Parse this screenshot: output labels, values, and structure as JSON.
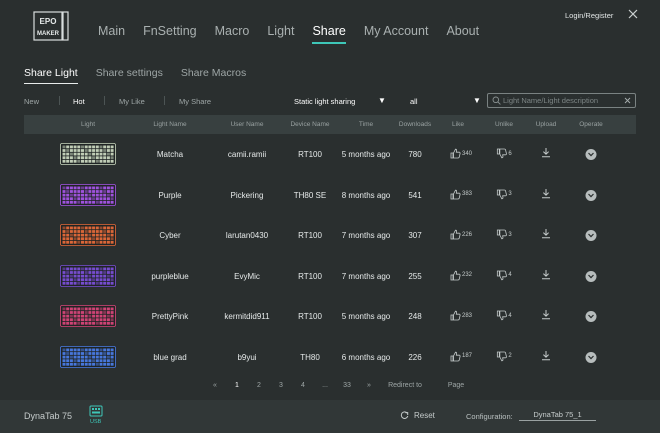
{
  "brand": {
    "logo_text": "EPOMAKER",
    "accent": "#3ec7b8",
    "bg": "#2a2f2f"
  },
  "header": {
    "nav": [
      "Main",
      "FnSetting",
      "Macro",
      "Light",
      "Share",
      "My Account",
      "About"
    ],
    "active_nav": "Share",
    "login_label": "Login/Register",
    "close_icon": "close-icon"
  },
  "subtabs": {
    "items": [
      "Share Light",
      "Share settings",
      "Share Macros"
    ],
    "active": "Share Light"
  },
  "filters": {
    "new": "New",
    "hot": "Hot",
    "my_like": "My Like",
    "my_share": "My Share",
    "type_value": "Static light sharing",
    "scope_value": "all",
    "search_placeholder": "Light Name/Light description"
  },
  "table": {
    "headers": [
      "Light",
      "Light Name",
      "User Name",
      "Device Name",
      "Time",
      "Downloads",
      "Like",
      "Unlike",
      "Upload",
      "Operate"
    ],
    "rows": [
      {
        "name": "Matcha",
        "user": "camii.ramii",
        "device": "RT100",
        "time": "5 months ago",
        "downloads": "780",
        "likes": "340",
        "unlikes": "6",
        "theme_color": "#c9d7bf"
      },
      {
        "name": "Purple",
        "user": "Pickering",
        "device": "TH80 SE",
        "time": "8 months ago",
        "downloads": "541",
        "likes": "383",
        "unlikes": "3",
        "theme_color": "#a655e8"
      },
      {
        "name": "Cyber",
        "user": "larutan0430",
        "device": "RT100",
        "time": "7 months ago",
        "downloads": "307",
        "likes": "226",
        "unlikes": "3",
        "theme_color": "#e56a3a"
      },
      {
        "name": "purpleblue",
        "user": "EvyMic",
        "device": "RT100",
        "time": "7 months ago",
        "downloads": "255",
        "likes": "232",
        "unlikes": "4",
        "theme_color": "#7b4fd8"
      },
      {
        "name": "PrettyPink",
        "user": "kermitdid911",
        "device": "RT100",
        "time": "5 months ago",
        "downloads": "248",
        "likes": "283",
        "unlikes": "4",
        "theme_color": "#d8467a"
      },
      {
        "name": "blue grad",
        "user": "b9yui",
        "device": "TH80",
        "time": "6 months ago",
        "downloads": "226",
        "likes": "187",
        "unlikes": "2",
        "theme_color": "#4a7ce6"
      }
    ]
  },
  "pagination": {
    "prev": "«",
    "pages": [
      "1",
      "2",
      "3",
      "4",
      "...",
      "33"
    ],
    "current": "1",
    "next": "»",
    "redirect": "Redirect to",
    "page": "Page"
  },
  "footer": {
    "device": "DynaTab 75",
    "usb_label": "USB",
    "reset": "Reset",
    "config_label": "Configuration:",
    "config_value": "DynaTab 75_1"
  }
}
